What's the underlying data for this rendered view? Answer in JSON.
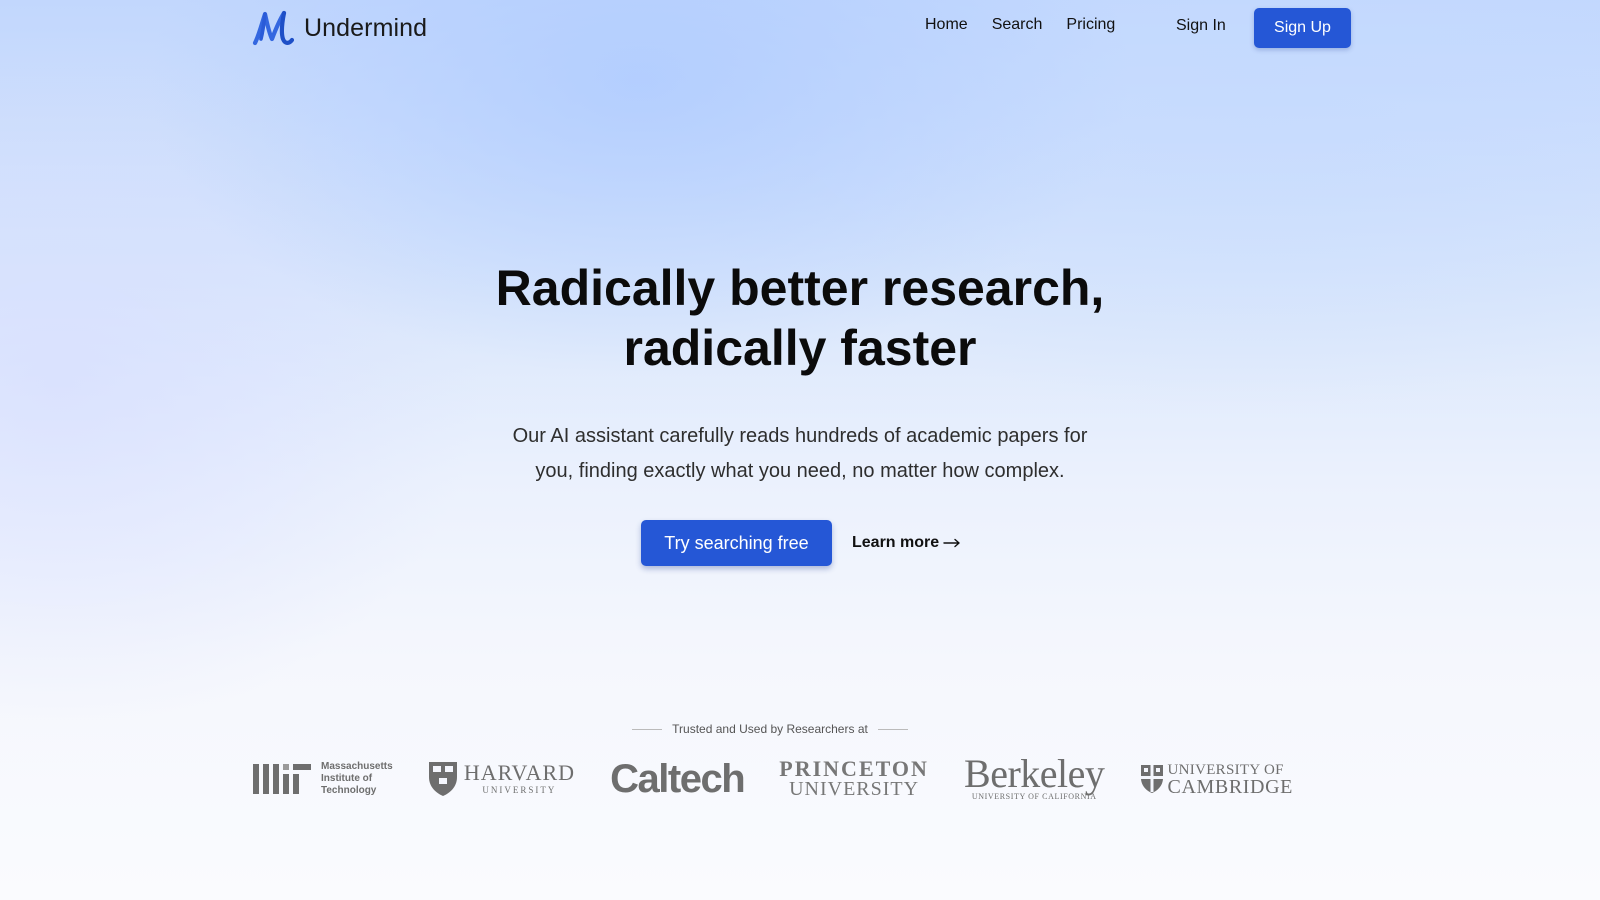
{
  "header": {
    "brand_name": "Undermind",
    "nav": {
      "home": "Home",
      "search": "Search",
      "pricing": "Pricing"
    },
    "sign_in": "Sign In",
    "sign_up": "Sign Up"
  },
  "hero": {
    "title_line1": "Radically better research,",
    "title_line2": "radically faster",
    "subtitle_line1": "Our AI assistant carefully reads hundreds of academic papers for",
    "subtitle_line2": "you, finding exactly what you need, no matter how complex.",
    "cta_primary": "Try searching free",
    "cta_secondary": "Learn more"
  },
  "trusted": {
    "label": "Trusted and Used by Researchers at",
    "logos": {
      "mit": {
        "line1": "Massachusetts",
        "line2": "Institute of",
        "line3": "Technology"
      },
      "harvard": {
        "name": "HARVARD",
        "sub": "UNIVERSITY"
      },
      "caltech": {
        "name": "Caltech"
      },
      "princeton": {
        "line1": "PRINCETON",
        "line2": "UNIVERSITY"
      },
      "berkeley": {
        "name": "Berkeley",
        "sub": "UNIVERSITY OF CALIFORNIA"
      },
      "cambridge": {
        "line1": "UNIVERSITY OF",
        "line2": "CAMBRIDGE"
      }
    }
  },
  "colors": {
    "accent": "#2557d6",
    "logo_gray": "#6e6e6e"
  }
}
